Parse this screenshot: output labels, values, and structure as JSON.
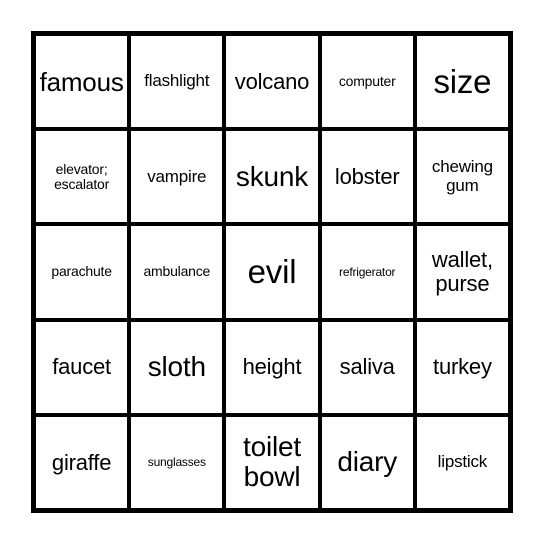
{
  "card": {
    "type": "bingo-card",
    "rows": 5,
    "columns": 5,
    "border_color": "#000000",
    "cell_background": "#ffffff",
    "text_color": "#000000",
    "cells": [
      {
        "text": "famous",
        "size": "fs-xl"
      },
      {
        "text": "flashlight",
        "size": "fs-m"
      },
      {
        "text": "volcano",
        "size": "fs-l"
      },
      {
        "text": "computer",
        "size": "fs-s"
      },
      {
        "text": "size",
        "size": "fs-huge"
      },
      {
        "text": "elevator;\nescalator",
        "size": "fs-s"
      },
      {
        "text": "vampire",
        "size": "fs-m"
      },
      {
        "text": "skunk",
        "size": "fs-xxl"
      },
      {
        "text": "lobster",
        "size": "fs-l"
      },
      {
        "text": "chewing\ngum",
        "size": "fs-m"
      },
      {
        "text": "parachute",
        "size": "fs-s"
      },
      {
        "text": "ambulance",
        "size": "fs-s"
      },
      {
        "text": "evil",
        "size": "fs-huge"
      },
      {
        "text": "refrigerator",
        "size": "fs-xs"
      },
      {
        "text": "wallet,\npurse",
        "size": "fs-l"
      },
      {
        "text": "faucet",
        "size": "fs-l"
      },
      {
        "text": "sloth",
        "size": "fs-xxl"
      },
      {
        "text": "height",
        "size": "fs-l"
      },
      {
        "text": "saliva",
        "size": "fs-l"
      },
      {
        "text": "turkey",
        "size": "fs-l"
      },
      {
        "text": "giraffe",
        "size": "fs-l"
      },
      {
        "text": "sunglasses",
        "size": "fs-xs"
      },
      {
        "text": "toilet\nbowl",
        "size": "fs-xxl"
      },
      {
        "text": "diary",
        "size": "fs-xxl"
      },
      {
        "text": "lipstick",
        "size": "fs-m"
      }
    ]
  }
}
